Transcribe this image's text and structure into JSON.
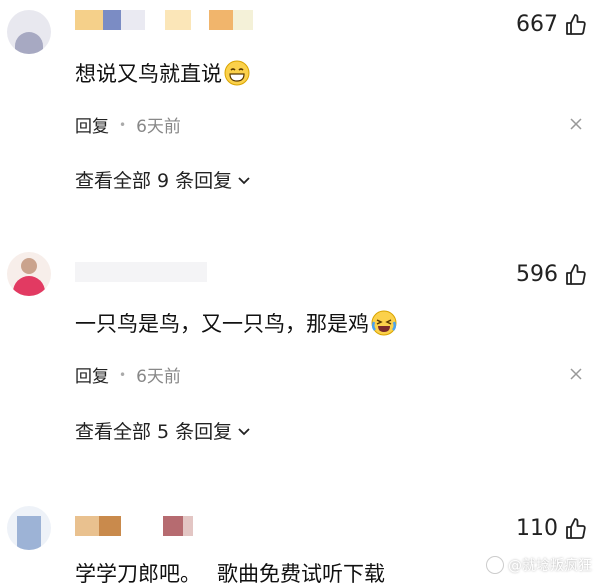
{
  "comments": [
    {
      "likes": "667",
      "text": "想说又鸟就直说",
      "emoji": "grin-emoji",
      "reply_label": "回复",
      "time": "6天前",
      "view_replies": "查看全部 9 条回复"
    },
    {
      "likes": "596",
      "text": "一只鸟是鸟，又一只鸟，那是鸡",
      "emoji": "laugh-cry-emoji",
      "reply_label": "回复",
      "time": "6天前",
      "view_replies": "查看全部 5 条回复"
    },
    {
      "likes": "110",
      "text": "学学刀郎吧。",
      "suffix": "歌曲免费试听下载"
    }
  ],
  "watermark": "@就埝叛疯狂",
  "icons": {
    "like": "thumbs-up-icon",
    "close": "close-icon",
    "chevron": "chevron-down-icon"
  }
}
